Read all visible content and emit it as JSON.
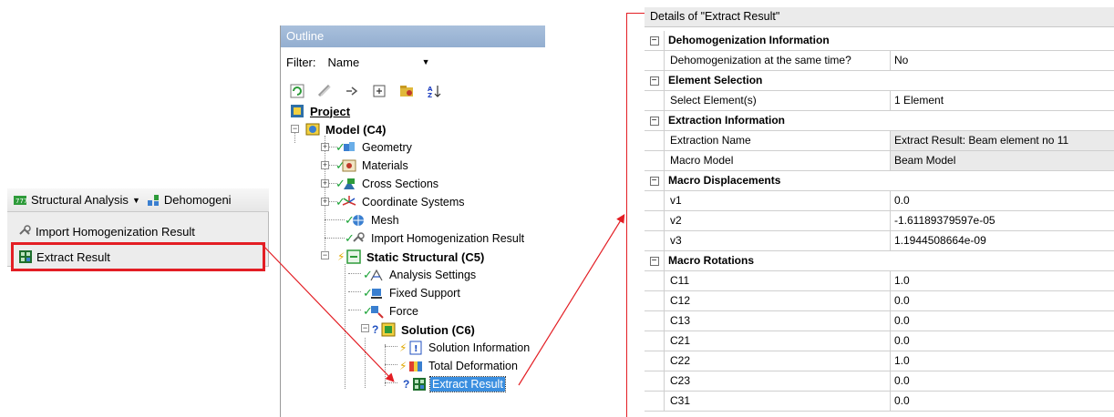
{
  "menu": {
    "toolbar_label": "Structural Analysis",
    "toolbar_next": "Dehomogeni",
    "items": [
      {
        "label": "Import Homogenization Result"
      },
      {
        "label": "Extract Result"
      }
    ]
  },
  "outline": {
    "title": "Outline",
    "filter_label": "Filter:",
    "filter_value": "Name",
    "tree": {
      "project": "Project",
      "model": "Model (C4)",
      "geometry": "Geometry",
      "materials": "Materials",
      "cross_sections": "Cross Sections",
      "coordinate_systems": "Coordinate Systems",
      "mesh": "Mesh",
      "import_homog": "Import Homogenization Result",
      "static_structural": "Static Structural (C5)",
      "analysis_settings": "Analysis Settings",
      "fixed_support": "Fixed Support",
      "force": "Force",
      "solution": "Solution (C6)",
      "solution_information": "Solution Information",
      "total_deformation": "Total Deformation",
      "extract_result": "Extract Result"
    }
  },
  "details": {
    "title": "Details of \"Extract Result\"",
    "rows": [
      {
        "kind": "group",
        "name": "Dehomogenization Information"
      },
      {
        "kind": "prop",
        "name": "Dehomogenization at the same time?",
        "value": "No"
      },
      {
        "kind": "group",
        "name": "Element Selection"
      },
      {
        "kind": "prop",
        "name": "Select Element(s)",
        "value": "1 Element"
      },
      {
        "kind": "group",
        "name": "Extraction Information"
      },
      {
        "kind": "prop",
        "name": "Extraction Name",
        "value": "Extract Result: Beam element no 11"
      },
      {
        "kind": "prop",
        "name": "Macro Model",
        "value": "Beam Model"
      },
      {
        "kind": "group",
        "name": "Macro Displacements"
      },
      {
        "kind": "prop",
        "name": "v1",
        "value": "0.0"
      },
      {
        "kind": "prop",
        "name": "v2",
        "value": "-1.61189379597e-05"
      },
      {
        "kind": "prop",
        "name": "v3",
        "value": "1.1944508664e-09"
      },
      {
        "kind": "group",
        "name": "Macro Rotations"
      },
      {
        "kind": "prop",
        "name": "C11",
        "value": "1.0"
      },
      {
        "kind": "prop",
        "name": "C12",
        "value": "0.0"
      },
      {
        "kind": "prop",
        "name": "C13",
        "value": "0.0"
      },
      {
        "kind": "prop",
        "name": "C21",
        "value": "0.0"
      },
      {
        "kind": "prop",
        "name": "C22",
        "value": "1.0"
      },
      {
        "kind": "prop",
        "name": "C23",
        "value": "0.0"
      },
      {
        "kind": "prop",
        "name": "C31",
        "value": "0.0"
      }
    ]
  },
  "colors": {
    "highlight": "#e31e24",
    "selection": "#3b8fe0",
    "title_bar": "#93aed0"
  }
}
